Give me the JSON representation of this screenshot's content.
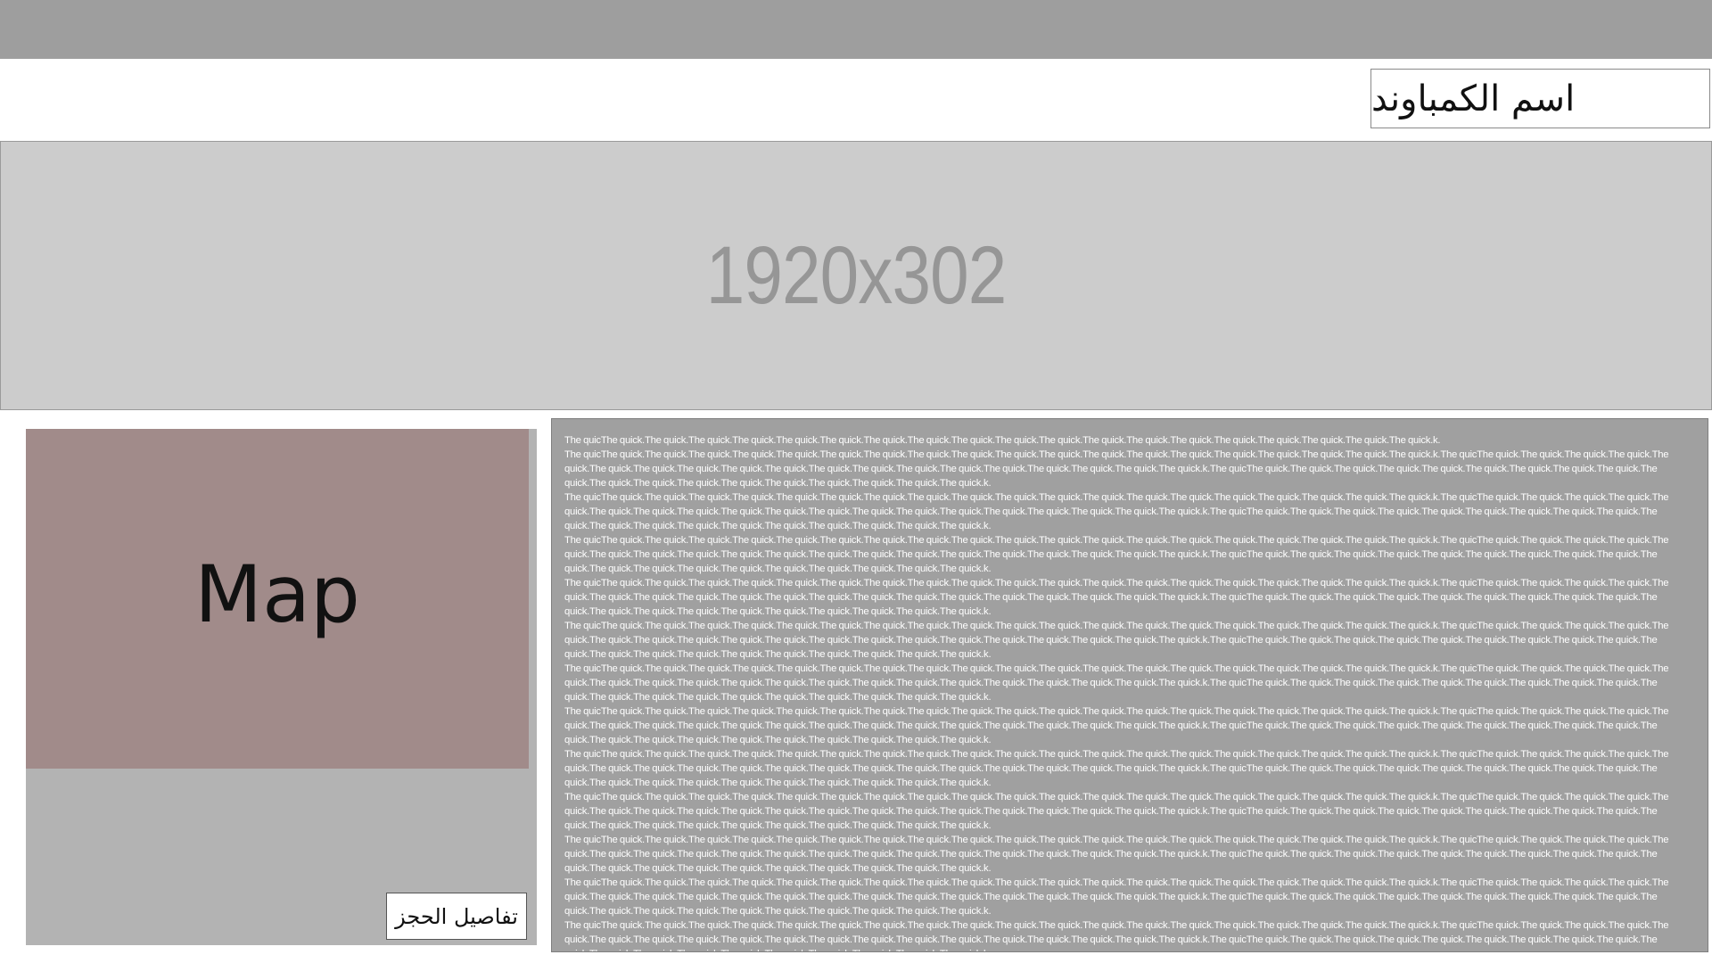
{
  "header": {
    "compound_name": "اسم الكمباوند"
  },
  "banner": {
    "placeholder_text": "1920x302"
  },
  "map": {
    "label": "Map",
    "booking_button_label": "تفاصيل الحجز"
  },
  "description": {
    "paragraphs": [
      "The quicThe quick.The quick.The quick.The quick.The quick.The quick.The quick.The quick.The quick.The quick.The quick.The quick.The quick.The quick.The quick.The quick.The quick.The quick.The quick.k.",
      "The quicThe quick.The quick.The quick.The quick.The quick.The quick.The quick.The quick.The quick.The quick.The quick.The quick.The quick.The quick.The quick.The quick.The quick.The quick.The quick.k.The quicThe quick.The quick.The quick.The quick.The quick.The quick.The quick.The quick.The quick.The quick.The quick.The quick.The quick.The quick.The quick.The quick.The quick.The quick.The quick.k.The quicThe quick.The quick.The quick.The quick.The quick.The quick.The quick.The quick.The quick.The quick.The quick.The quick.The quick.The quick.The quick.The quick.The quick.The quick.The quick.k.",
      "The quicThe quick.The quick.The quick.The quick.The quick.The quick.The quick.The quick.The quick.The quick.The quick.The quick.The quick.The quick.The quick.The quick.The quick.The quick.The quick.k.The quicThe quick.The quick.The quick.The quick.The quick.The quick.The quick.The quick.The quick.The quick.The quick.The quick.The quick.The quick.The quick.The quick.The quick.The quick.The quick.k.The quicThe quick.The quick.The quick.The quick.The quick.The quick.The quick.The quick.The quick.The quick.The quick.The quick.The quick.The quick.The quick.The quick.The quick.The quick.The quick.k.",
      "The quicThe quick.The quick.The quick.The quick.The quick.The quick.The quick.The quick.The quick.The quick.The quick.The quick.The quick.The quick.The quick.The quick.The quick.The quick.The quick.k.The quicThe quick.The quick.The quick.The quick.The quick.The quick.The quick.The quick.The quick.The quick.The quick.The quick.The quick.The quick.The quick.The quick.The quick.The quick.The quick.k.The quicThe quick.The quick.The quick.The quick.The quick.The quick.The quick.The quick.The quick.The quick.The quick.The quick.The quick.The quick.The quick.The quick.The quick.The quick.The quick.k.",
      "The quicThe quick.The quick.The quick.The quick.The quick.The quick.The quick.The quick.The quick.The quick.The quick.The quick.The quick.The quick.The quick.The quick.The quick.The quick.The quick.k.The quicThe quick.The quick.The quick.The quick.The quick.The quick.The quick.The quick.The quick.The quick.The quick.The quick.The quick.The quick.The quick.The quick.The quick.The quick.The quick.k.The quicThe quick.The quick.The quick.The quick.The quick.The quick.The quick.The quick.The quick.The quick.The quick.The quick.The quick.The quick.The quick.The quick.The quick.The quick.The quick.k.",
      "The quicThe quick.The quick.The quick.The quick.The quick.The quick.The quick.The quick.The quick.The quick.The quick.The quick.The quick.The quick.The quick.The quick.The quick.The quick.The quick.k.The quicThe quick.The quick.The quick.The quick.The quick.The quick.The quick.The quick.The quick.The quick.The quick.The quick.The quick.The quick.The quick.The quick.The quick.The quick.The quick.k.The quicThe quick.The quick.The quick.The quick.The quick.The quick.The quick.The quick.The quick.The quick.The quick.The quick.The quick.The quick.The quick.The quick.The quick.The quick.The quick.k.",
      "The quicThe quick.The quick.The quick.The quick.The quick.The quick.The quick.The quick.The quick.The quick.The quick.The quick.The quick.The quick.The quick.The quick.The quick.The quick.The quick.k.The quicThe quick.The quick.The quick.The quick.The quick.The quick.The quick.The quick.The quick.The quick.The quick.The quick.The quick.The quick.The quick.The quick.The quick.The quick.The quick.k.The quicThe quick.The quick.The quick.The quick.The quick.The quick.The quick.The quick.The quick.The quick.The quick.The quick.The quick.The quick.The quick.The quick.The quick.The quick.The quick.k.",
      "The quicThe quick.The quick.The quick.The quick.The quick.The quick.The quick.The quick.The quick.The quick.The quick.The quick.The quick.The quick.The quick.The quick.The quick.The quick.The quick.k.The quicThe quick.The quick.The quick.The quick.The quick.The quick.The quick.The quick.The quick.The quick.The quick.The quick.The quick.The quick.The quick.The quick.The quick.The quick.The quick.k.The quicThe quick.The quick.The quick.The quick.The quick.The quick.The quick.The quick.The quick.The quick.The quick.The quick.The quick.The quick.The quick.The quick.The quick.The quick.The quick.k.",
      "The quicThe quick.The quick.The quick.The quick.The quick.The quick.The quick.The quick.The quick.The quick.The quick.The quick.The quick.The quick.The quick.The quick.The quick.The quick.The quick.k.The quicThe quick.The quick.The quick.The quick.The quick.The quick.The quick.The quick.The quick.The quick.The quick.The quick.The quick.The quick.The quick.The quick.The quick.The quick.The quick.k.The quicThe quick.The quick.The quick.The quick.The quick.The quick.The quick.The quick.The quick.The quick.The quick.The quick.The quick.The quick.The quick.The quick.The quick.The quick.The quick.k.",
      "The quicThe quick.The quick.The quick.The quick.The quick.The quick.The quick.The quick.The quick.The quick.The quick.The quick.The quick.The quick.The quick.The quick.The quick.The quick.The quick.k.The quicThe quick.The quick.The quick.The quick.The quick.The quick.The quick.The quick.The quick.The quick.The quick.The quick.The quick.The quick.The quick.The quick.The quick.The quick.The quick.k.The quicThe quick.The quick.The quick.The quick.The quick.The quick.The quick.The quick.The quick.The quick.The quick.The quick.The quick.The quick.The quick.The quick.The quick.The quick.The quick.k.",
      "The quicThe quick.The quick.The quick.The quick.The quick.The quick.The quick.The quick.The quick.The quick.The quick.The quick.The quick.The quick.The quick.The quick.The quick.The quick.The quick.k.The quicThe quick.The quick.The quick.The quick.The quick.The quick.The quick.The quick.The quick.The quick.The quick.The quick.The quick.The quick.The quick.The quick.The quick.The quick.The quick.k.The quicThe quick.The quick.The quick.The quick.The quick.The quick.The quick.The quick.The quick.The quick.The quick.The quick.The quick.The quick.The quick.The quick.The quick.The quick.The quick.k.",
      "The quicThe quick.The quick.The quick.The quick.The quick.The quick.The quick.The quick.The quick.The quick.The quick.The quick.The quick.The quick.The quick.The quick.The quick.The quick.The quick.k.The quicThe quick.The quick.The quick.The quick.The quick.The quick.The quick.The quick.The quick.The quick.The quick.The quick.The quick.The quick.The quick.The quick.The quick.The quick.The quick.k.The quicThe quick.The quick.The quick.The quick.The quick.The quick.The quick.The quick.The quick.The quick.The quick.The quick.The quick.The quick.The quick.The quick.The quick.The quick.The quick.k.",
      "The quicThe quick.The quick.The quick.The quick.The quick.The quick.The quick.The quick.The quick.The quick.The quick.The quick.The quick.The quick.The quick.The quick.The quick.The quick.The quick.k.The quicThe quick.The quick.The quick.The quick.The quick.The quick.The quick.The quick.The quick.The quick.The quick.The quick.The quick.The quick.The quick.The quick.The quick.The quick.The quick.k.The quicThe quick.The quick.The quick.The quick.The quick.The quick.The quick.The quick.The quick.The quick.The quick.The quick.The quick.The quick.The quick.The quick.The quick.The quick.The quick.k."
    ]
  }
}
